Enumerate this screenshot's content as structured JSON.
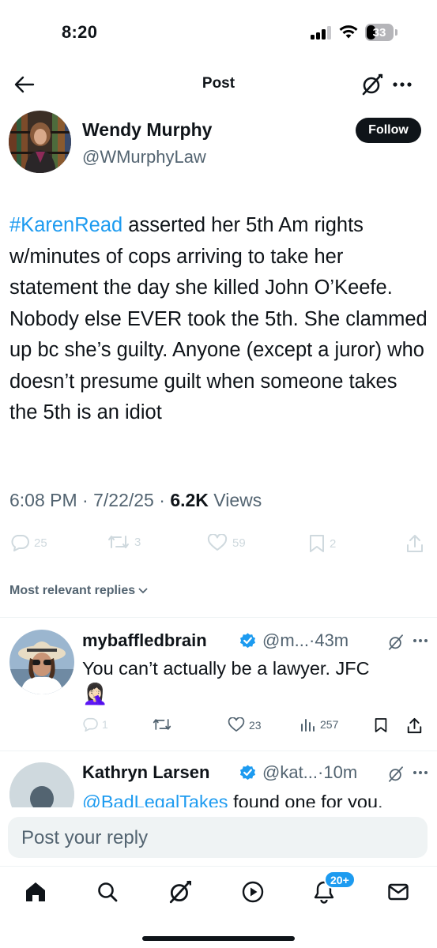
{
  "status_bar": {
    "time": "8:20",
    "battery": "33"
  },
  "nav": {
    "title": "Post"
  },
  "post": {
    "author_name": "Wendy Murphy",
    "author_handle": "@WMurphyLaw",
    "follow_label": "Follow",
    "hashtag": "#KarenRead",
    "body": " asserted her 5th Am rights w/minutes of cops arriving to take her statement the day she killed John O’Keefe. Nobody else EVER took the 5th. She clammed up bc she’s guilty. Anyone (except a juror) who doesn’t presume guilt when someone takes the 5th is an idiot",
    "time": "6:08 PM",
    "date": "7/22/25",
    "views_count": "6.2K",
    "views_label": "Views",
    "replies": "25",
    "reposts": "3",
    "likes": "59",
    "bookmarks": "2"
  },
  "replies_section": {
    "sort_label": "Most relevant replies"
  },
  "replies": [
    {
      "name": "mybaffledbrain",
      "handle": "@m...",
      "time": "43m",
      "text": "You can’t actually be a lawyer. JFC",
      "emoji": "🤦🏻‍♀️",
      "reply_count": "1",
      "like_count": "23",
      "view_count": "257"
    },
    {
      "name": "Kathryn Larsen",
      "handle": "@kat...",
      "time": "10m",
      "mention": "@BadLegalTakes",
      "text": " found one for you."
    }
  ],
  "composer": {
    "placeholder": "Post your reply"
  },
  "tabbar": {
    "notification_badge": "20+"
  },
  "colors": {
    "accent": "#1d9bf0",
    "text": "#0f1419",
    "secondary": "#536471",
    "faint": "#cfd9de"
  },
  "icons": [
    "back-arrow-icon",
    "grok-icon",
    "more-icon",
    "reply-icon",
    "repost-icon",
    "like-icon",
    "bookmark-icon",
    "share-icon",
    "views-icon",
    "verified-icon",
    "home-icon",
    "search-icon",
    "play-icon",
    "bell-icon",
    "mail-icon"
  ]
}
